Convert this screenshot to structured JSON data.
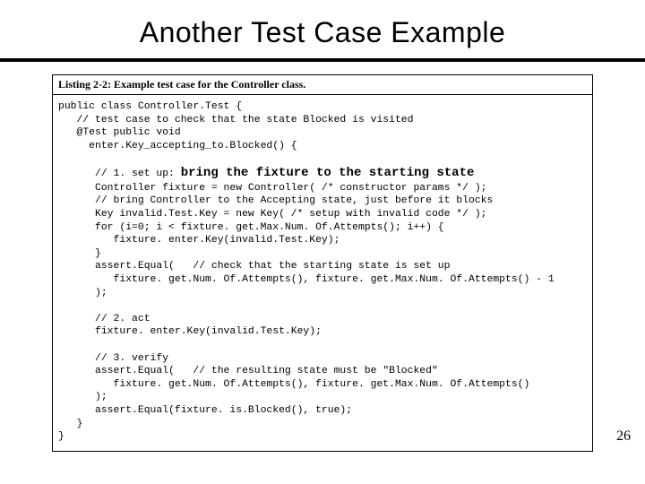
{
  "title": "Another Test Case Example",
  "listing_caption": "Listing 2-2: Example test case for the Controller class.",
  "code": {
    "l01": "public class Controller.Test {",
    "l02": "   // test case to check that the state Blocked is visited",
    "l03": "   @Test public void",
    "l04": "     enter.Key_accepting_to.Blocked() {",
    "l05": "",
    "l06a": "      // 1. set up: ",
    "l06b": "bring the fixture to the starting state",
    "l07": "      Controller fixture = new Controller( /* constructor params */ );",
    "l08": "      // bring Controller to the Accepting state, just before it blocks",
    "l09": "      Key invalid.Test.Key = new Key( /* setup with invalid code */ );",
    "l10": "      for (i=0; i < fixture. get.Max.Num. Of.Attempts(); i++) {",
    "l11": "         fixture. enter.Key(invalid.Test.Key);",
    "l12": "      }",
    "l13": "      assert.Equal(   // check that the starting state is set up",
    "l14": "         fixture. get.Num. Of.Attempts(), fixture. get.Max.Num. Of.Attempts() - 1",
    "l15": "      );",
    "l16": "",
    "l17": "      // 2. act",
    "l18": "      fixture. enter.Key(invalid.Test.Key);",
    "l19": "",
    "l20": "      // 3. verify",
    "l21": "      assert.Equal(   // the resulting state must be \"Blocked\"",
    "l22": "         fixture. get.Num. Of.Attempts(), fixture. get.Max.Num. Of.Attempts()",
    "l23": "      );",
    "l24": "      assert.Equal(fixture. is.Blocked(), true);",
    "l25": "   }",
    "l26": "}"
  },
  "page_number": "26"
}
